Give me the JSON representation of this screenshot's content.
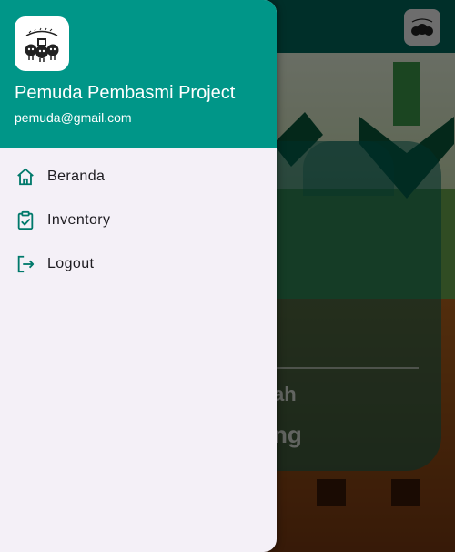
{
  "drawer": {
    "header": {
      "user_name": "Pemuda Pembasmi Project",
      "user_email": "pemuda@gmail.com",
      "logo_icon": "team-logo-icon"
    },
    "menu": [
      {
        "label": "Beranda",
        "icon": "home-icon"
      },
      {
        "label": "Inventory",
        "icon": "clipboard-check-icon"
      },
      {
        "label": "Logout",
        "icon": "logout-icon"
      }
    ]
  },
  "background": {
    "avatar_icon": "team-logo-icon",
    "card_text_1": "ah",
    "card_text_2": "ng"
  },
  "colors": {
    "primary": "#009688",
    "appbar": "#00695c",
    "drawer_bg": "#f4f0f7",
    "icon": "#00796b",
    "text": "#1d1b20"
  }
}
